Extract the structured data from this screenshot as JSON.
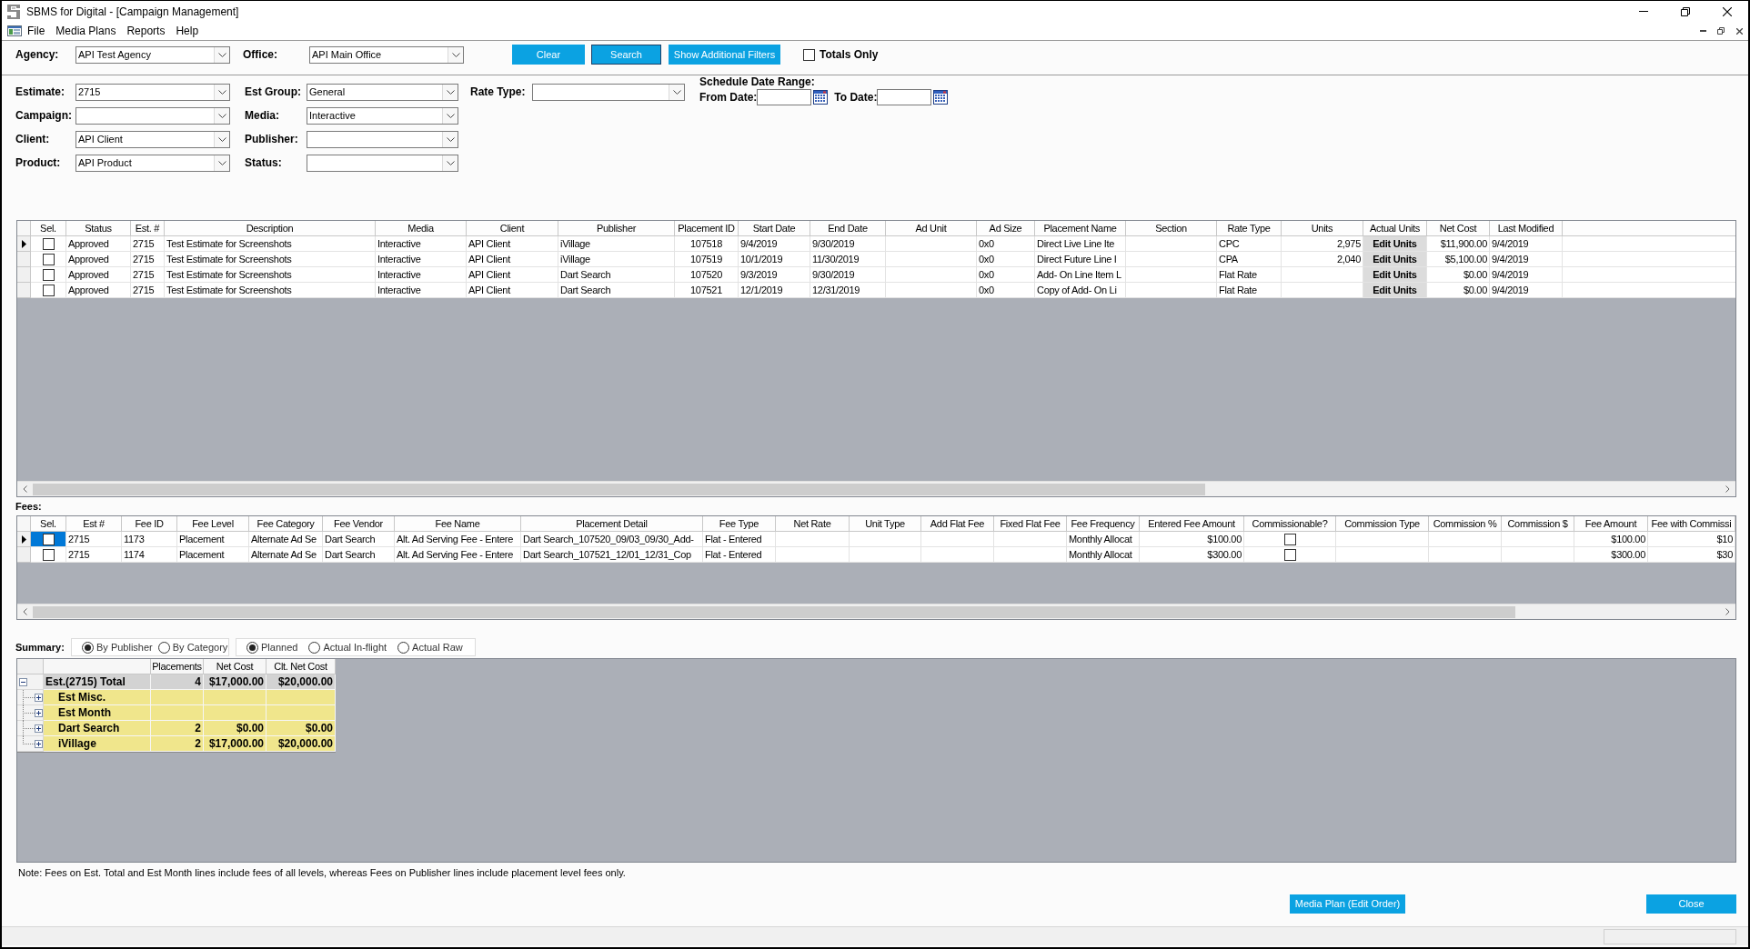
{
  "window": {
    "title": "SBMS for Digital - [Campaign Management]"
  },
  "menu": [
    "File",
    "Media Plans",
    "Reports",
    "Help"
  ],
  "toolbar": {
    "agency": {
      "label": "Agency:",
      "value": "API Test Agency"
    },
    "office": {
      "label": "Office:",
      "value": "API Main Office"
    },
    "buttons": [
      {
        "label": "Clear",
        "focused": false
      },
      {
        "label": "Search",
        "focused": true
      },
      {
        "label": "Show Additional Filters",
        "focused": false
      }
    ],
    "totals_only": {
      "label": "Totals Only",
      "checked": false
    }
  },
  "filters": {
    "column_1": [
      {
        "label": "Estimate:",
        "value": "2715"
      },
      {
        "label": "Campaign:"
      },
      {
        "label": "Client:",
        "value": "API Client"
      },
      {
        "label": "Product:",
        "value": "API Product"
      }
    ],
    "column_2": [
      {
        "label": "Est Group:",
        "value": "General"
      },
      {
        "label": "Media:",
        "value": "Interactive"
      },
      {
        "label": "Publisher:"
      },
      {
        "label": "Status:"
      }
    ],
    "rate_type": {
      "label": "Rate Type:"
    },
    "schedule": {
      "title": "Schedule Date Range:",
      "from": {
        "label": "From Date:"
      },
      "to": {
        "label": "To Date:"
      }
    }
  },
  "placements": {
    "columns": [
      "Sel.",
      "Status",
      "Est. #",
      "Description",
      "Media",
      "Client",
      "Publisher",
      "Placement ID",
      "Start Date",
      "End Date",
      "Ad Unit",
      "Ad Size",
      "Placement Name",
      "Section",
      "Rate Type",
      "Units",
      "Actual Units",
      "Net Cost",
      "Last Modified"
    ],
    "rows": [
      {
        "current": true,
        "checked": false,
        "status": "Approved",
        "est": "2715",
        "description": "Test Estimate for Screenshots",
        "media": "Interactive",
        "client": "API Client",
        "publisher": "iVillage",
        "placement_id": "107518",
        "start_date": "9/4/2019",
        "end_date": "9/30/2019",
        "ad_size": "0x0",
        "placement_name": "Direct Live Line Ite",
        "rate_type": "CPC",
        "units": "2,975",
        "actual_units": "Edit Units",
        "net_cost": "$11,900.00",
        "last_modified": "9/4/2019"
      },
      {
        "current": false,
        "checked": false,
        "status": "Approved",
        "est": "2715",
        "description": "Test Estimate for Screenshots",
        "media": "Interactive",
        "client": "API Client",
        "publisher": "iVillage",
        "placement_id": "107519",
        "start_date": "10/1/2019",
        "end_date": "11/30/2019",
        "ad_size": "0x0",
        "placement_name": "Direct Future Line I",
        "rate_type": "CPA",
        "units": "2,040",
        "actual_units": "Edit Units",
        "net_cost": "$5,100.00",
        "last_modified": "9/4/2019"
      },
      {
        "current": false,
        "checked": false,
        "status": "Approved",
        "est": "2715",
        "description": "Test Estimate for Screenshots",
        "media": "Interactive",
        "client": "API Client",
        "publisher": "Dart Search",
        "placement_id": "107520",
        "start_date": "9/3/2019",
        "end_date": "9/30/2019",
        "ad_size": "0x0",
        "placement_name": "Add- On Line Item L",
        "rate_type": "Flat Rate",
        "actual_units": "Edit Units",
        "net_cost": "$0.00",
        "last_modified": "9/4/2019"
      },
      {
        "current": false,
        "checked": false,
        "status": "Approved",
        "est": "2715",
        "description": "Test Estimate for Screenshots",
        "media": "Interactive",
        "client": "API Client",
        "publisher": "Dart Search",
        "placement_id": "107521",
        "start_date": "12/1/2019",
        "end_date": "12/31/2019",
        "ad_size": "0x0",
        "placement_name": "Copy of Add- On Li",
        "rate_type": "Flat Rate",
        "actual_units": "Edit Units",
        "net_cost": "$0.00",
        "last_modified": "9/4/2019"
      }
    ]
  },
  "fees": {
    "label": "Fees:",
    "columns": [
      "Sel.",
      "Est #",
      "Fee ID",
      "Fee Level",
      "Fee Category",
      "Fee Vendor",
      "Fee Name",
      "Placement Detail",
      "Fee Type",
      "Net Rate",
      "Unit Type",
      "Add Flat Fee",
      "Fixed Flat Fee",
      "Fee Frequency",
      "Entered Fee Amount",
      "Commissionable?",
      "Commission Type",
      "Commission %",
      "Commission $",
      "Fee Amount",
      "Fee with Commissi"
    ],
    "rows": [
      {
        "current": true,
        "selected": true,
        "checked": false,
        "est": "2715",
        "fee_id": "1173",
        "fee_level": "Placement",
        "fee_category": "Alternate Ad Se",
        "fee_vendor": "Dart Search",
        "fee_name": "Alt. Ad Serving Fee - Entere",
        "placement_detail": "Dart Search_107520_09/03_09/30_Add-",
        "fee_type": "Flat - Entered",
        "fee_frequency": "Monthly Allocat",
        "entered_fee_amount": "$100.00",
        "commissionable": false,
        "fee_amount": "$100.00",
        "fee_with_commission": "$10"
      },
      {
        "current": false,
        "selected": false,
        "checked": false,
        "est": "2715",
        "fee_id": "1174",
        "fee_level": "Placement",
        "fee_category": "Alternate Ad Se",
        "fee_vendor": "Dart Search",
        "fee_name": "Alt. Ad Serving Fee - Entere",
        "placement_detail": "Dart Search_107521_12/01_12/31_Cop",
        "fee_type": "Flat - Entered",
        "fee_frequency": "Monthly Allocat",
        "entered_fee_amount": "$300.00",
        "commissionable": false,
        "fee_amount": "$300.00",
        "fee_with_commission": "$30"
      }
    ]
  },
  "summary": {
    "label": "Summary:",
    "group_by": [
      {
        "label": "By Publisher",
        "selected": true
      },
      {
        "label": "By Category",
        "selected": false
      }
    ],
    "basis": [
      {
        "label": "Planned",
        "selected": true
      },
      {
        "label": "Actual In-flight",
        "selected": false
      },
      {
        "label": "Actual Raw",
        "selected": false
      }
    ],
    "columns": [
      "Placements",
      "Net Cost",
      "Clt. Net Cost"
    ],
    "tree": [
      {
        "name": "Est.(2715) Total",
        "expanded": true,
        "placements": "4",
        "net_cost": "$17,000.00",
        "clt_net_cost": "$20,000.00",
        "children": [
          {
            "name": "Est Misc.",
            "expanded": false
          },
          {
            "name": "Est Month",
            "expanded": false
          },
          {
            "name": "Dart Search",
            "expanded": false,
            "placements": "2",
            "net_cost": "$0.00",
            "clt_net_cost": "$0.00"
          },
          {
            "name": "iVillage",
            "expanded": false,
            "placements": "2",
            "net_cost": "$17,000.00",
            "clt_net_cost": "$20,000.00"
          }
        ]
      }
    ]
  },
  "note": "Note: Fees on Est. Total and Est Month lines include fees of all levels, whereas Fees on Publisher lines include placement level fees only.",
  "actions": [
    "Media Plan (Edit Order)",
    "Close"
  ]
}
